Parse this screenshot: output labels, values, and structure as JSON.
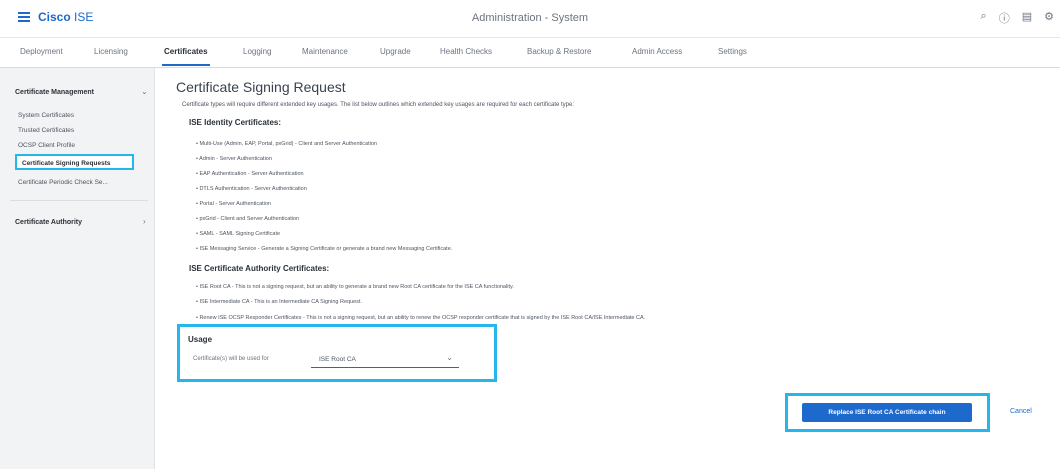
{
  "header": {
    "brand_prefix": "Cisco",
    "brand_suffix": "ISE",
    "page_heading": "Administration - System",
    "icons": [
      "search-icon",
      "help-icon",
      "dashboard-icon",
      "settings-icon"
    ]
  },
  "tabs": [
    {
      "label": "Deployment"
    },
    {
      "label": "Licensing"
    },
    {
      "label": "Certificates",
      "active": true
    },
    {
      "label": "Logging"
    },
    {
      "label": "Maintenance"
    },
    {
      "label": "Upgrade"
    },
    {
      "label": "Health Checks"
    },
    {
      "label": "Backup & Restore"
    },
    {
      "label": "Admin Access"
    },
    {
      "label": "Settings"
    }
  ],
  "sidebar": {
    "sections": [
      {
        "title": "Certificate Management",
        "items": [
          {
            "label": "System Certificates"
          },
          {
            "label": "Trusted Certificates"
          },
          {
            "label": "OCSP Client Profile"
          },
          {
            "label": "Certificate Signing Requests",
            "selected": true
          },
          {
            "label": "Certificate Periodic Check Se..."
          }
        ]
      },
      {
        "title": "Certificate Authority",
        "items": []
      }
    ]
  },
  "main": {
    "title": "Certificate Signing Request",
    "description": "Certificate types will require different extended key usages. The list below outlines which extended key usages are required for each certificate type:",
    "identity_heading": "ISE Identity Certificates:",
    "identity_bullets": [
      "• Multi-Use (Admin, EAP, Portal, pxGrid) - Client and Server Authentication",
      "• Admin - Server Authentication",
      "• EAP Authentication - Server Authentication",
      "• DTLS Authentication - Server Authentication",
      "• Portal - Server Authentication",
      "• pxGrid - Client and Server Authentication",
      "• SAML - SAML Signing Certificate",
      "• ISE Messaging Service - Generate a Signing Certificate or generate a brand new Messaging Certificate."
    ],
    "ca_heading": "ISE Certificate Authority Certificates:",
    "ca_bullets": [
      "• ISE Root CA - This is not a signing request, but an ability to generate a brand new Root CA certificate for the ISE CA functionality.",
      "• ISE Intermediate CA - This is an Intermediate CA Signing Request.",
      "• Renew ISE OCSP Responder Certificates - This is not a signing request, but an ability to renew the OCSP responder certificate that is signed by the ISE Root CA/ISE Intermediate CA."
    ]
  },
  "usage": {
    "title": "Usage",
    "field_label": "Certificate(s) will be used for",
    "selected_value": "ISE Root CA"
  },
  "actions": {
    "primary_label": "Replace ISE Root CA Certificate chain",
    "cancel_label": "Cancel"
  },
  "colors": {
    "accent": "#1d69cc",
    "highlight": "#25b6ec"
  }
}
